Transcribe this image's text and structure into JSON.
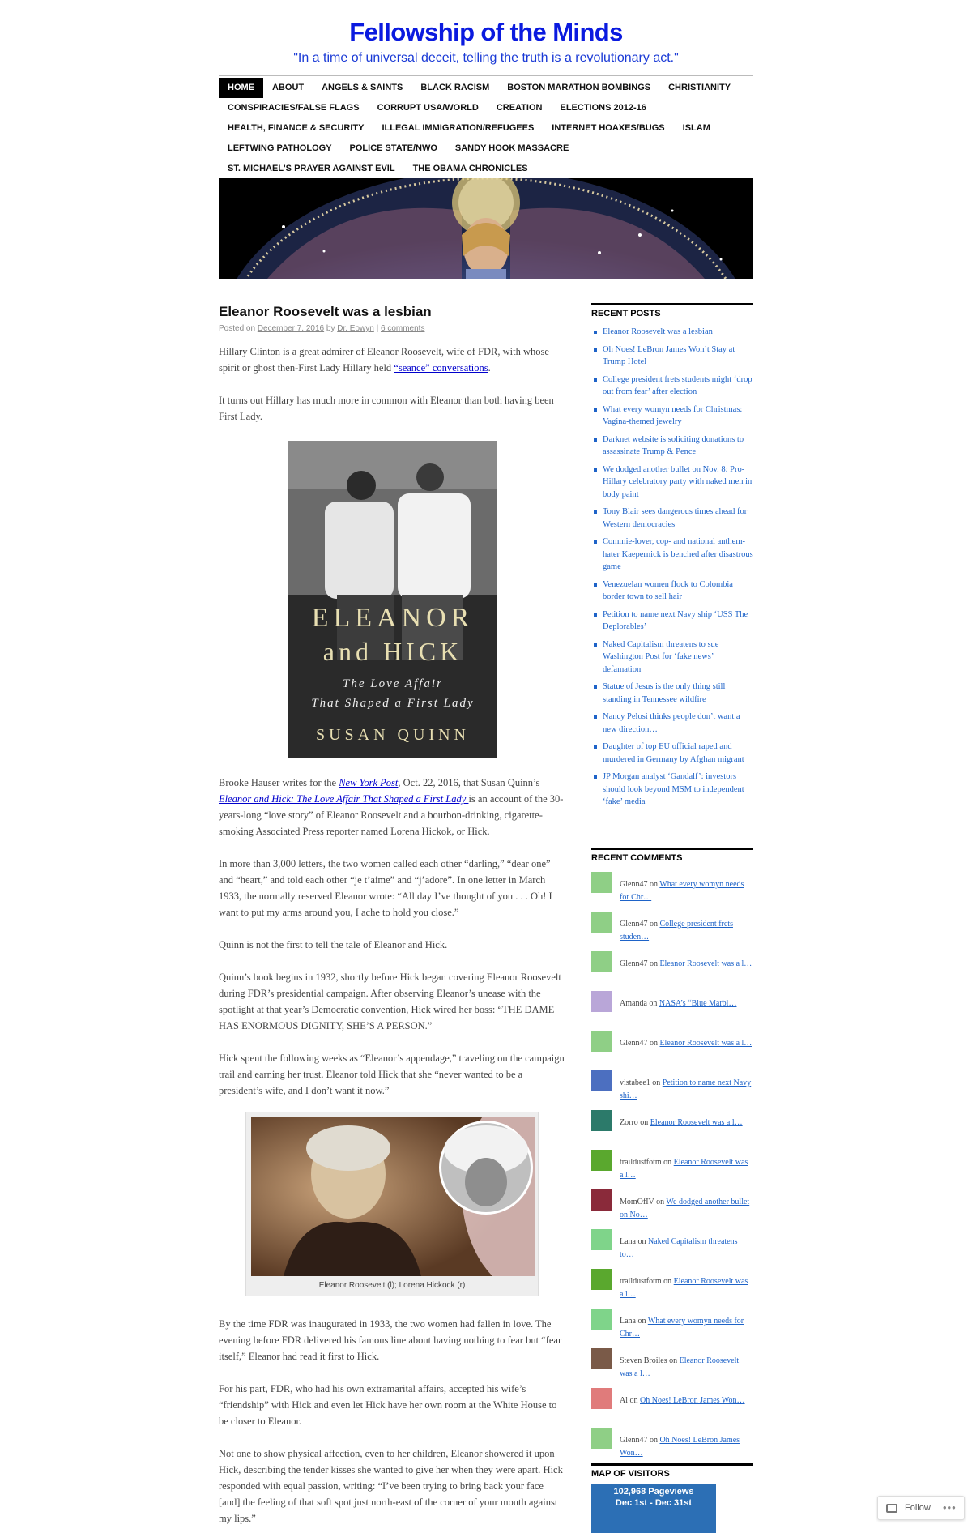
{
  "site": {
    "title": "Fellowship of the Minds",
    "description": "\"In a time of universal deceit, telling the truth is a revolutionary act.\""
  },
  "nav": {
    "rows": [
      [
        "HOME",
        "ABOUT",
        "ANGELS & SAINTS",
        "BLACK RACISM",
        "BOSTON MARATHON BOMBINGS",
        "CHRISTIANITY"
      ],
      [
        "CONSPIRACIES/FALSE FLAGS",
        "CORRUPT USA/WORLD",
        "CREATION",
        "ELECTIONS 2012-16"
      ],
      [
        "HEALTH, FINANCE & SECURITY",
        "ILLEGAL IMMIGRATION/REFUGEES",
        "INTERNET HOAXES/BUGS",
        "ISLAM"
      ],
      [
        "LEFTWING PATHOLOGY",
        "POLICE STATE/NWO",
        "SANDY HOOK MASSACRE"
      ],
      [
        "ST. MICHAEL'S PRAYER AGAINST EVIL",
        "THE OBAMA CHRONICLES"
      ]
    ]
  },
  "post": {
    "title": "Eleanor Roosevelt was a lesbian",
    "meta": {
      "posted_on": "Posted on",
      "date": "December 7, 2016",
      "by": "by",
      "author": "Dr. Eowyn",
      "sep": "|",
      "comments": "6 comments"
    },
    "p1": {
      "a": "Hillary Clinton is a great admirer of Eleanor Roosevelt, wife of FDR, with whose spirit or ghost then-First Lady Hillary held ",
      "link": "“seance” conversations",
      "b": "."
    },
    "p2": "It turns out Hillary has much more in common with Eleanor than both having been First Lady.",
    "cover": {
      "line1": "ELEANOR",
      "line2": "and HICK",
      "line3": "The Love Affair",
      "line4": "That Shaped a First Lady",
      "author": "SUSAN QUINN"
    },
    "p3": {
      "a": "Brooke Hauser writes for the ",
      "link1": "New York Post",
      "b": ", Oct. 22, 2016, that Susan Quinn’s ",
      "link2": "Eleanor and Hick: The Love Affair That Shaped a First Lady ",
      "c": "is an account of the 30-years-long “love story” of Eleanor Roosevelt and a bourbon-drinking, cigarette-smoking Associated Press reporter named Lorena Hickok, or Hick."
    },
    "p4": "In more than 3,000 letters, the two women called each other “darling,” “dear one” and “heart,” and told each other “je t’aime” and “j’adore”. In one letter in March 1933, the normally reserved Eleanor wrote: “All day I’ve thought of you . . . Oh! I want to put my arms around you, I ache to hold you close.”",
    "p5": "Quinn is not the first to tell the tale of Eleanor and Hick.",
    "p6": "Quinn’s book begins in 1932, shortly before Hick began covering Eleanor Roosevelt during FDR’s presidential campaign. After observing Eleanor’s unease with the spotlight at that year’s Democratic convention, Hick wired her boss: “THE DAME HAS ENORMOUS DIGNITY, SHE’S A PERSON.”",
    "p7": "Hick spent the following weeks as “Eleanor’s appendage,” traveling on the campaign trail and earning her trust. Eleanor told Hick that she “never wanted to be a president’s wife, and I don’t want it now.”",
    "photo_caption": "Eleanor Roosevelt (l); Lorena Hickock (r)",
    "p8": "By the time FDR was inaugurated in 1933, the two women had fallen in love. The evening before FDR delivered his famous line about having nothing to fear but “fear itself,” Eleanor had read it first to Hick.",
    "p9": "For his part, FDR, who had his own extramarital affairs, accepted his wife’s “friendship” with Hick and even let Hick have her own room at the White House to be closer to Eleanor.",
    "p10": "Not one to show physical affection, even to her children, Eleanor showered it upon Hick, describing the tender kisses she wanted to give her when they were apart. Hick responded with equal passion, writing: “I’ve been trying to bring back your face [and] the feeling of that soft spot just north-east of the corner of your mouth against my lips.”"
  },
  "sidebar": {
    "recent_posts_title": "RECENT POSTS",
    "recent_posts": [
      "Eleanor Roosevelt was a lesbian",
      "Oh Noes! LeBron James Won’t Stay at Trump Hotel",
      "College president frets students might ‘drop out from fear’ after election",
      "What every womyn needs for Christmas: Vagina-themed jewelry",
      "Darknet website is soliciting donations to assassinate Trump & Pence",
      "We dodged another bullet on Nov. 8: Pro-Hillary celebratory party with naked men in body paint",
      "Tony Blair sees dangerous times ahead for Western democracies",
      "Commie-lover, cop- and national anthem-hater Kaepernick is benched after disastrous game",
      "Venezuelan women flock to Colombia border town to sell hair",
      "Petition to name next Navy ship ‘USS The Deplorables’",
      "Naked Capitalism threatens to sue Washington Post for ‘fake news’ defamation",
      "Statue of Jesus is the only thing still standing in Tennessee wildfire",
      "Nancy Pelosi thinks people don’t want a new direction…",
      "Daughter of top EU official raped and murdered in Germany by Afghan migrant",
      "JP Morgan analyst ‘Gandalf’: investors should look beyond MSM to independent ‘fake’ media"
    ],
    "recent_comments_title": "RECENT COMMENTS",
    "recent_comments": [
      {
        "author": "Glenn47",
        "on": "on",
        "link": "What every womyn needs for Chr…",
        "color": "#8fcf86"
      },
      {
        "author": "Glenn47",
        "on": "on",
        "link": "College president frets studen…",
        "color": "#8fcf86"
      },
      {
        "author": "Glenn47",
        "on": "on",
        "link": "Eleanor Roosevelt was a l…",
        "color": "#8fcf86"
      },
      {
        "author": "Amanda",
        "on": "on",
        "link": "NASA’s “Blue Marbl…",
        "color": "#b9a6d8"
      },
      {
        "author": "Glenn47",
        "on": "on",
        "link": "Eleanor Roosevelt was a l…",
        "color": "#8fcf86"
      },
      {
        "author": "vistabee1",
        "on": "on",
        "link": "Petition to name next Navy shi…",
        "color": "#4c6fc0"
      },
      {
        "author": "Zorro",
        "on": "on",
        "link": "Eleanor Roosevelt was a l…",
        "color": "#2c7a6a"
      },
      {
        "author": "traildustfotm",
        "on": "on",
        "link": "Eleanor Roosevelt was a l…",
        "color": "#5aa82e"
      },
      {
        "author": "MomOfIV",
        "on": "on",
        "link": "We dodged another bullet on No…",
        "color": "#8a2a3a"
      },
      {
        "author": "Lana",
        "on": "on",
        "link": "Naked Capitalism threatens to…",
        "color": "#7fd48a"
      },
      {
        "author": "traildustfotm",
        "on": "on",
        "link": "Eleanor Roosevelt was a l…",
        "color": "#5aa82e"
      },
      {
        "author": "Lana",
        "on": "on",
        "link": "What every womyn needs for Chr…",
        "color": "#7fd48a"
      },
      {
        "author": "Steven Broiles",
        "on": "on",
        "link": "Eleanor Roosevelt was a l…",
        "color": "#7a5a48"
      },
      {
        "author": "Al",
        "on": "on",
        "link": "Oh Noes! LeBron James Won…",
        "color": "#e07b7b"
      },
      {
        "author": "Glenn47",
        "on": "on",
        "link": "Oh Noes! LeBron James Won…",
        "color": "#8fcf86"
      }
    ],
    "map_title": "MAP OF VISITORS",
    "map_pageviews": "102,968 Pageviews",
    "map_range": "Dec 1st - Dec 31st"
  },
  "follow_label": "Follow",
  "follow_more": "•••",
  "colors": {
    "title_blue": "#0a1adf",
    "link_blue": "#1e63c8",
    "nav_current_bg": "#000000"
  }
}
